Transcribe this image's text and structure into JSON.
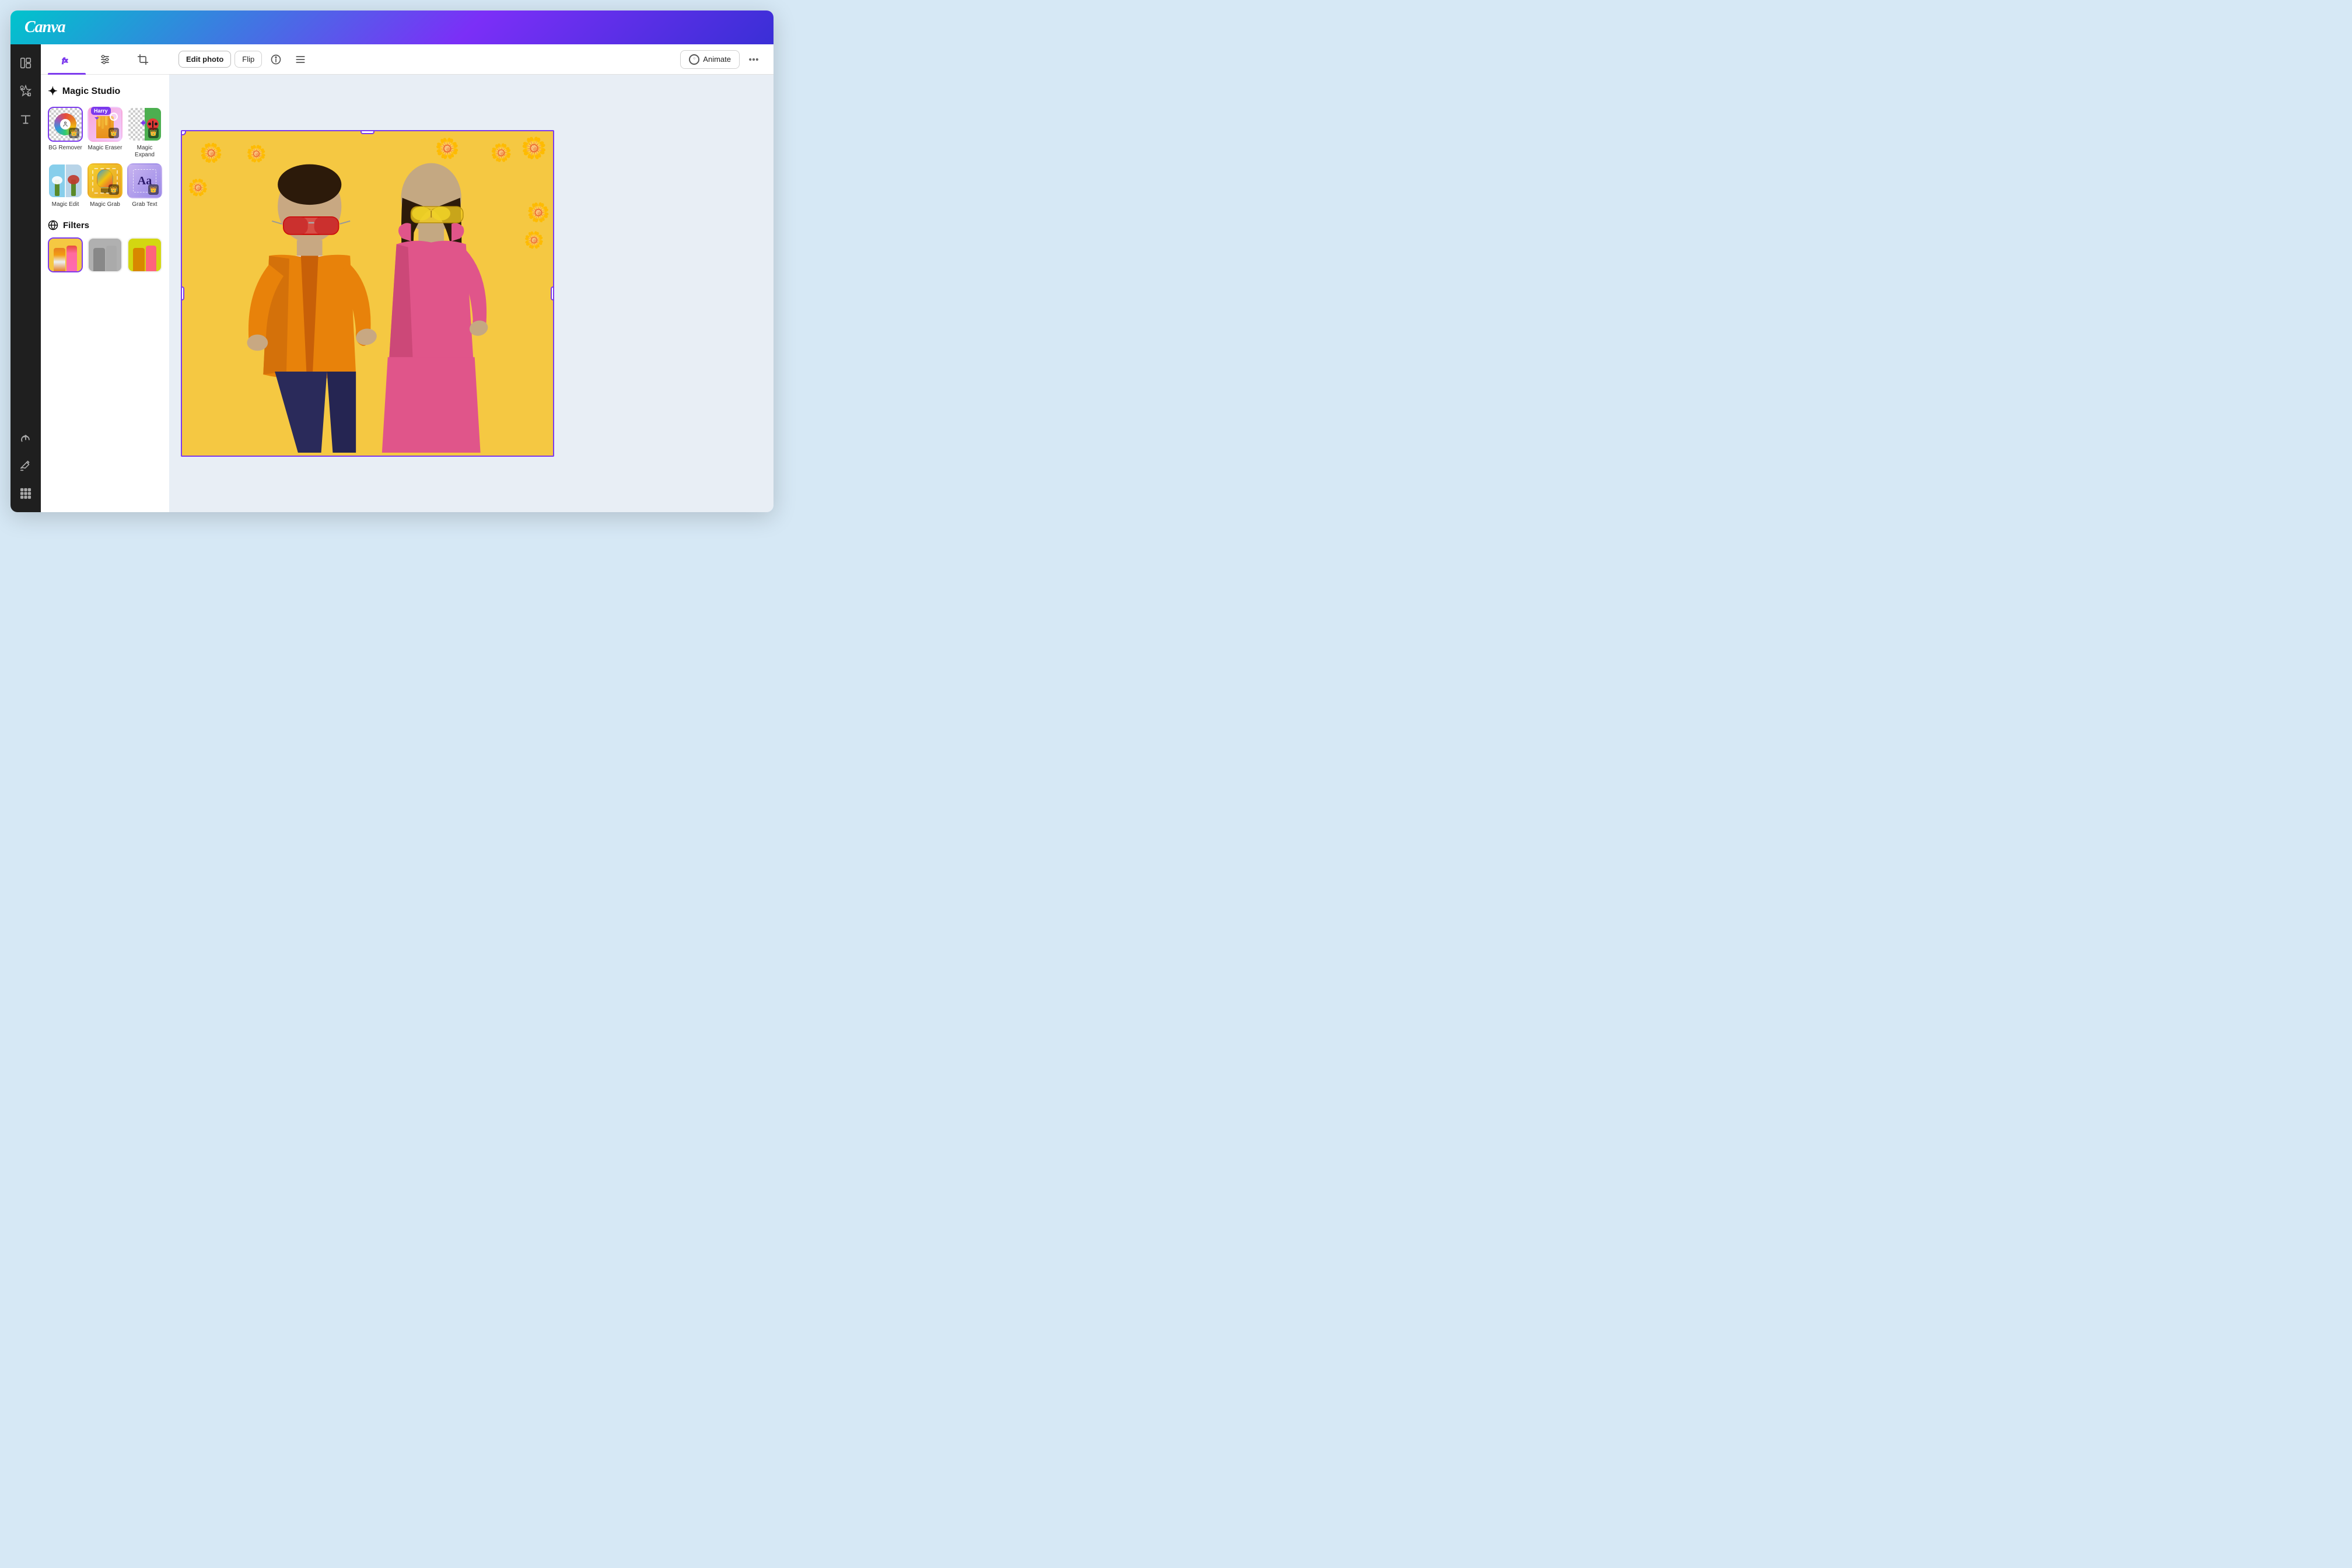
{
  "app": {
    "name": "Canva",
    "background_color": "#d6e8f5",
    "header_gradient": "linear-gradient(135deg, #00c4cc 0%, #7b2ff7 60%, #3a2fd6 100%)"
  },
  "sidebar": {
    "icons": [
      {
        "name": "panels-icon",
        "label": "Panels"
      },
      {
        "name": "elements-icon",
        "label": "Elements"
      },
      {
        "name": "text-icon",
        "label": "Text"
      },
      {
        "name": "upload-icon",
        "label": "Upload"
      },
      {
        "name": "draw-icon",
        "label": "Draw"
      },
      {
        "name": "apps-icon",
        "label": "Apps"
      }
    ]
  },
  "panel": {
    "tabs": [
      {
        "name": "effects-tab",
        "label": "Effects",
        "active": true
      },
      {
        "name": "adjust-tab",
        "label": "Adjust",
        "active": false
      },
      {
        "name": "crop-tab",
        "label": "Crop",
        "active": false
      }
    ],
    "magic_studio": {
      "heading": "Magic Studio",
      "tools": [
        {
          "id": "bg-remover",
          "label": "BG Remover",
          "selected": true,
          "crown": true
        },
        {
          "id": "magic-eraser",
          "label": "Magic Eraser",
          "crown": true,
          "badge": "Harry"
        },
        {
          "id": "magic-expand",
          "label": "Magic Expand",
          "crown": true
        },
        {
          "id": "magic-edit",
          "label": "Magic Edit",
          "crown": false
        },
        {
          "id": "magic-grab",
          "label": "Magic Grab",
          "crown": true
        },
        {
          "id": "grab-text",
          "label": "Grab Text",
          "crown": true
        }
      ]
    },
    "filters": {
      "heading": "Filters",
      "items": [
        {
          "id": "original",
          "label": ""
        },
        {
          "id": "grayscale",
          "label": ""
        },
        {
          "id": "warm",
          "label": ""
        }
      ]
    }
  },
  "toolbar": {
    "edit_photo_label": "Edit photo",
    "flip_label": "Flip",
    "animate_label": "Animate",
    "more_label": "..."
  },
  "canvas": {
    "selection_color": "#7c3aed"
  }
}
